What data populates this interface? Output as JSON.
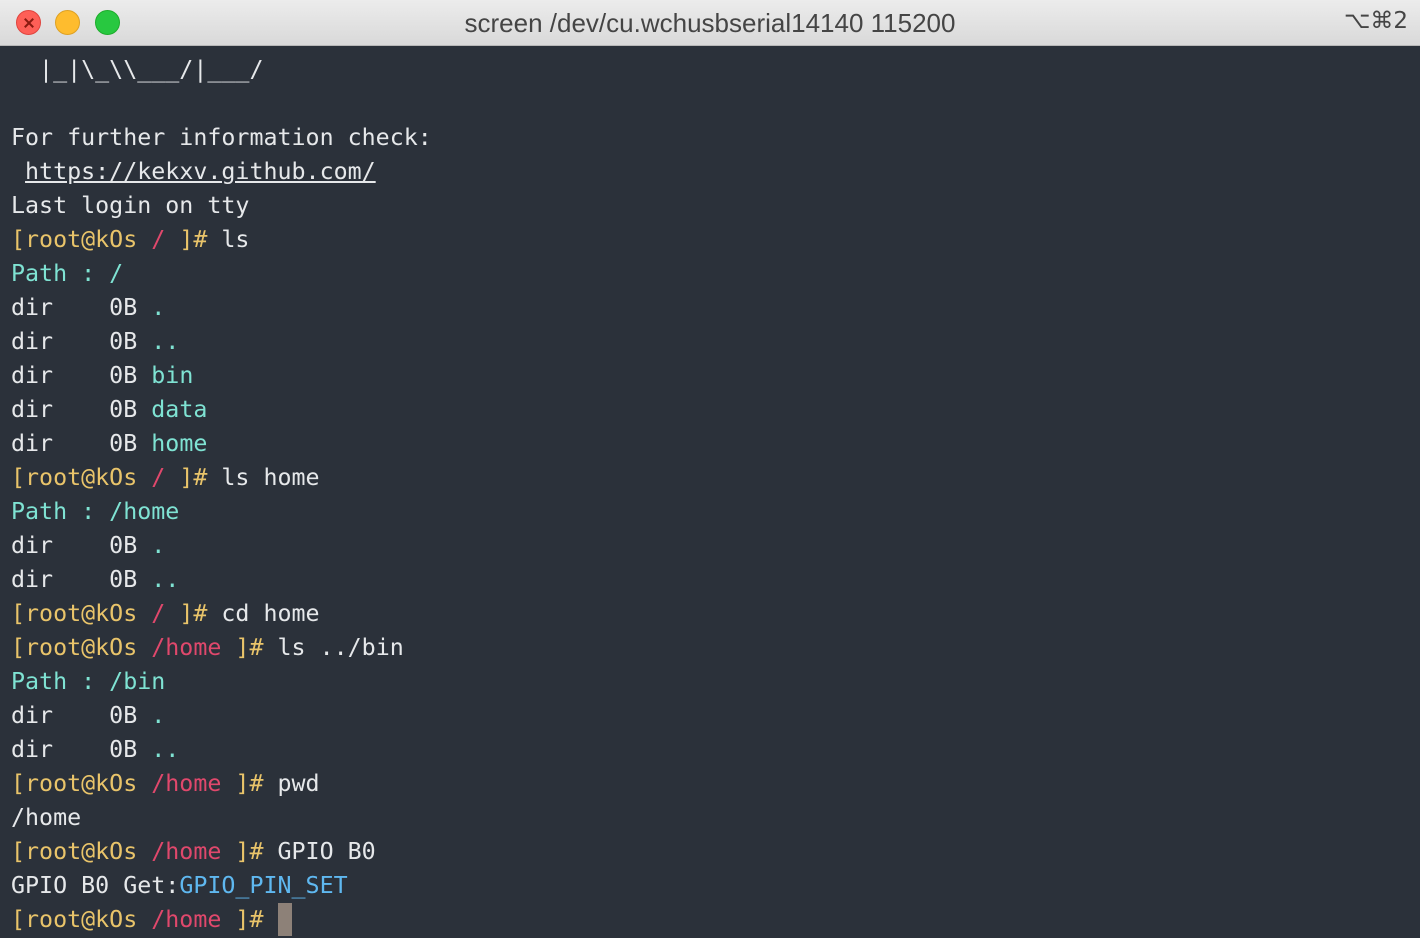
{
  "window": {
    "title": "screen /dev/cu.wchusbserial14140 115200",
    "shortcut": "⌥⌘2"
  },
  "prompt": {
    "open": "[root@kOs",
    "close": "]#"
  },
  "lines": {
    "l0": "  |_|\\_\\\\___/|___/",
    "l1": "",
    "l2": "For further information check:",
    "l3_url": "https://kekxv.github.com/",
    "l4": "Last login on tty",
    "l5_path": " / ",
    "l5_cmd": " ls",
    "l6": "Path : /",
    "l7_a": "dir    0B ",
    "l7_b": ".",
    "l8_a": "dir    0B ",
    "l8_b": "..",
    "l9_a": "dir    0B ",
    "l9_b": "bin",
    "l10_a": "dir    0B ",
    "l10_b": "data",
    "l11_a": "dir    0B ",
    "l11_b": "home",
    "l12_path": " / ",
    "l12_cmd": " ls home",
    "l13": "Path : /home",
    "l14_a": "dir    0B ",
    "l14_b": ".",
    "l15_a": "dir    0B ",
    "l15_b": "..",
    "l16_path": " / ",
    "l16_cmd": " cd home",
    "l17_path": " /home ",
    "l17_cmd": " ls ../bin",
    "l18": "Path : /bin",
    "l19_a": "dir    0B ",
    "l19_b": ".",
    "l20_a": "dir    0B ",
    "l20_b": "..",
    "l21_path": " /home ",
    "l21_cmd": " pwd",
    "l22": "/home",
    "l23_path": " /home ",
    "l23_cmd": " GPIO B0",
    "l24_a": "GPIO B0 Get:",
    "l24_b": "GPIO_PIN_SET",
    "l25_path": " /home ",
    "l25_cmd": " "
  },
  "colors": {
    "background": "#2b313a",
    "text": "#e6e8ea",
    "prompt": "#e9c46a",
    "path": "#e0486c",
    "info": "#7fe3d3",
    "value": "#5fb8f0"
  }
}
